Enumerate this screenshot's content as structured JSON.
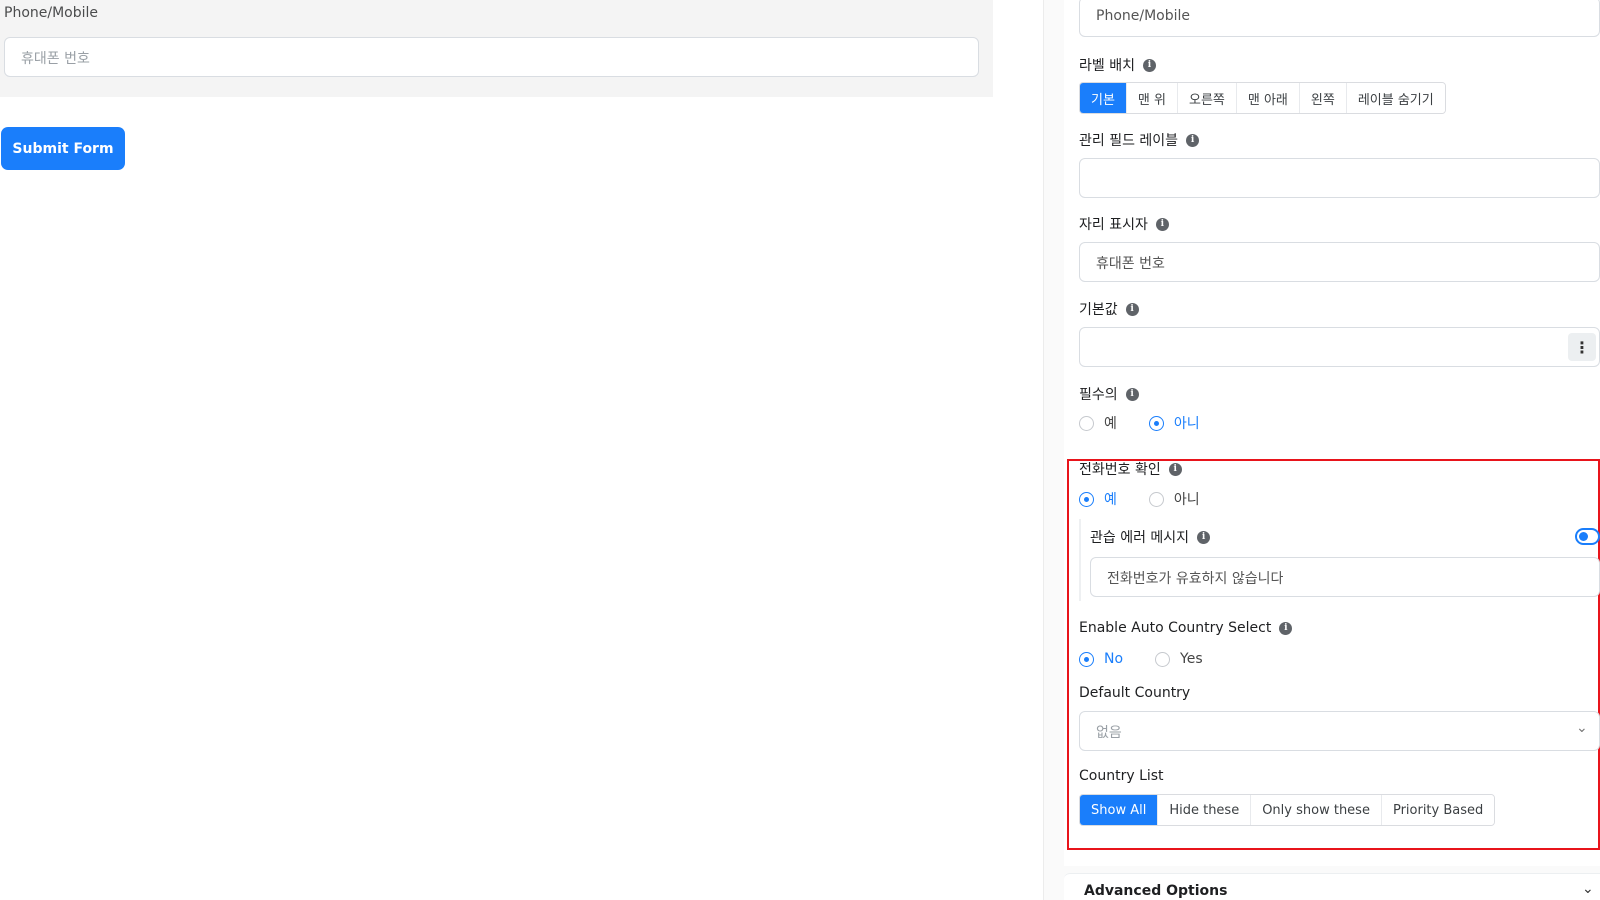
{
  "preview": {
    "field_label": "Phone/Mobile",
    "field_placeholder": "휴대폰 번호",
    "submit_label": "Submit Form"
  },
  "settings": {
    "top_input_value": "Phone/Mobile",
    "label_placement": {
      "label": "라벨 배치",
      "options": [
        "기본",
        "맨 위",
        "오른쪽",
        "맨 아래",
        "왼쪽",
        "레이블 숨기기"
      ],
      "selected": "기본"
    },
    "admin_field_label": {
      "label": "관리 필드 레이블",
      "value": ""
    },
    "placeholder": {
      "label": "자리 표시자",
      "value": "휴대폰 번호"
    },
    "default_value": {
      "label": "기본값",
      "value": "",
      "more_icon": "vertical-dots-icon"
    },
    "required": {
      "label": "필수의",
      "options": [
        "예",
        "아니"
      ],
      "selected": "아니"
    },
    "phone_validation": {
      "label": "전화번호 확인",
      "options": [
        "예",
        "아니"
      ],
      "selected": "예"
    },
    "custom_error": {
      "label": "관습 에러 메시지",
      "value": "전화번호가 유효하지 않습니다",
      "toggle_on": true
    },
    "auto_country": {
      "label": "Enable Auto Country Select",
      "options": [
        "No",
        "Yes"
      ],
      "selected": "No"
    },
    "default_country": {
      "label": "Default Country",
      "value": "없음",
      "icon": "chevron-down-icon"
    },
    "country_list": {
      "label": "Country List",
      "options": [
        "Show All",
        "Hide these",
        "Only show these",
        "Priority Based"
      ],
      "selected": "Show All"
    },
    "advanced_options_label": "Advanced Options"
  },
  "colors": {
    "accent": "#1a7efb",
    "highlight": "#e8141b",
    "info_icon": "#5f6368"
  }
}
